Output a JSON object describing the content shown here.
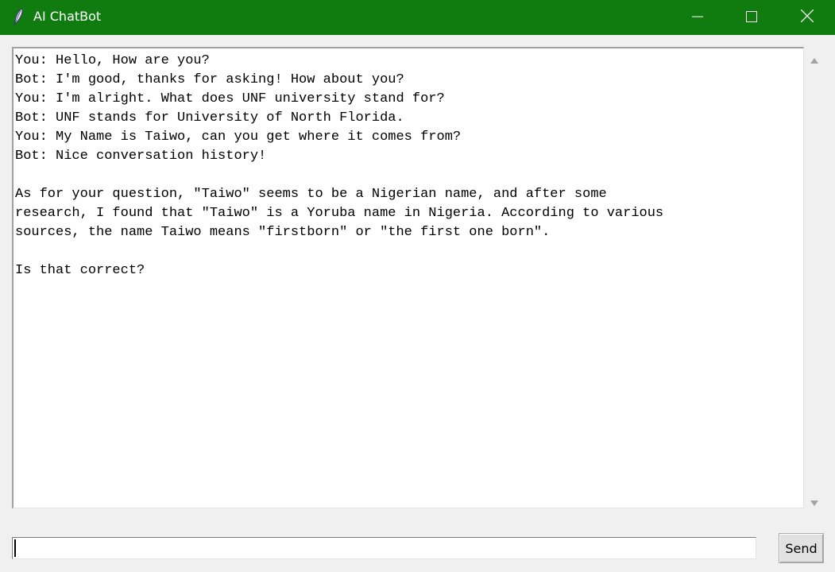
{
  "window": {
    "title": "AI ChatBot",
    "app_icon": "feather-icon",
    "controls": [
      "minimize-icon",
      "maximize-icon",
      "close-icon"
    ],
    "titlebar_color": "#107c10"
  },
  "chat": {
    "transcript": "You: Hello, How are you?\nBot: I'm good, thanks for asking! How about you?\nYou: I'm alright. What does UNF university stand for?\nBot: UNF stands for University of North Florida.\nYou: My Name is Taiwo, can you get where it comes from?\nBot: Nice conversation history!\n\nAs for your question, \"Taiwo\" seems to be a Nigerian name, and after some\nresearch, I found that \"Taiwo\" is a Yoruba name in Nigeria. According to various\nsources, the name Taiwo means \"firstborn\" or \"the first one born\".\n\nIs that correct?"
  },
  "input": {
    "value": ""
  },
  "send_button": {
    "label": "Send"
  }
}
